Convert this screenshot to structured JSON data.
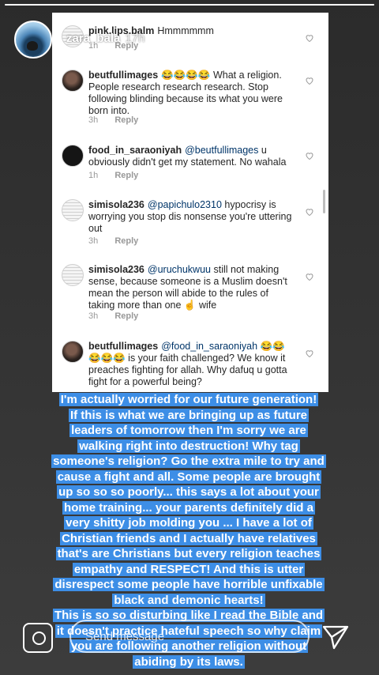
{
  "story": {
    "progress_fraction": 1.0,
    "username": "zara_bala",
    "time_ago": "17h"
  },
  "comments": [
    {
      "user": "pink.lips.balm",
      "text": "Hmmmmmm",
      "meta": [
        "1h",
        "Reply"
      ],
      "avatar": "doc"
    },
    {
      "user": "beutfullimages",
      "mention": "",
      "text": "😂😂😂😂 What a religion. People research research research. Stop following blinding because its what you were born into.",
      "time": "3h",
      "reply": "Reply",
      "avatar": "photo"
    },
    {
      "user": "food_in_saraoniyah",
      "mention": "@beutfullimages",
      "text": "u obviously didn't get my statement. No wahala",
      "time": "1h",
      "reply": "Reply",
      "avatar": "dark"
    },
    {
      "user": "simisola236",
      "mention": "@papichulo2310",
      "text": "hypocrisy is worrying you stop dis nonsense you're uttering out",
      "time": "3h",
      "reply": "Reply",
      "avatar": "doc"
    },
    {
      "user": "simisola236",
      "mention": "@uruchukwuu",
      "text": "still not making sense, because someone is a Muslim doesn't mean the person will abide to the rules of taking more than one ☝️ wife",
      "time": "3h",
      "reply": "Reply",
      "avatar": "doc"
    },
    {
      "user": "beutfullimages",
      "mention": "@food_in_saraoniyah",
      "text": "😂😂😂😂😂 is your faith challenged? We know it preaches fighting for allah. Why dafuq u gotta fight for a powerful being?",
      "time": "3h",
      "reply": "Reply",
      "avatar": "photo"
    }
  ],
  "overlay_lines": [
    "I'm actually worried for our future generation!",
    "If this is what we are bringing up as future",
    "leaders of tomorrow then I'm sorry we are",
    "walking right into destruction! Why tag",
    "someone's religion? Go the extra mile to try and",
    "cause a fight and all. Some people are brought",
    "up so so so poorly... this says a lot about your",
    "home training... your parents definitely did a",
    "very shitty job molding you ... I have a lot of",
    "Christian friends and I actually have relatives",
    "that's are Christians but every religion teaches",
    "empathy and RESPECT! And this is utter",
    "disrespect some people have horrible unfixable",
    "black and demonic hearts!",
    "This is so so disturbing like I read the Bible and",
    "it doesn't practice hateful speech so why claim",
    "you are following another religion without",
    "abiding by its laws."
  ],
  "send_message": {
    "placeholder": "Send message"
  },
  "icons": {
    "camera": "camera-icon",
    "send": "paper-plane-icon",
    "heart": "heart-outline-icon"
  },
  "colors": {
    "overlay_blue": "#3d8ee6",
    "mention": "#003569"
  }
}
